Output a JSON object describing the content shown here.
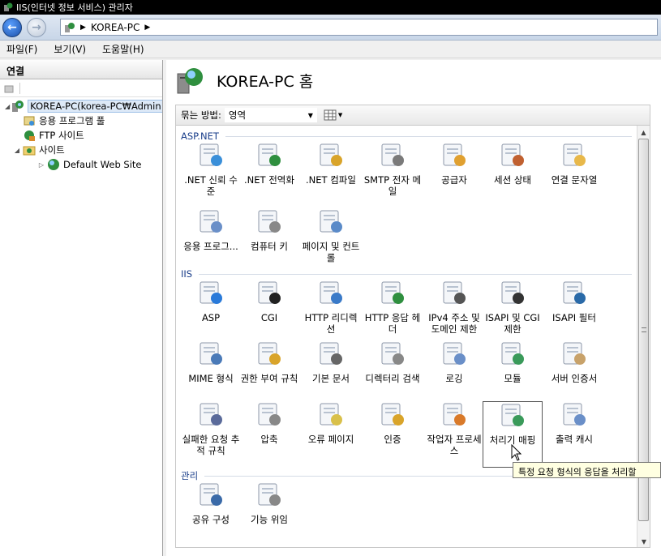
{
  "window": {
    "title": "IIS(인터넷 정보 서비스) 관리자"
  },
  "address": {
    "path": "KOREA-PC"
  },
  "menu": [
    "파일(F)",
    "보기(V)",
    "도움말(H)"
  ],
  "connections": {
    "title": "연결",
    "tree": [
      {
        "label": "KOREA-PC(korea-PC₩Admin"
      },
      {
        "label": "응용 프로그램 풀"
      },
      {
        "label": "FTP 사이트"
      },
      {
        "label": "사이트"
      },
      {
        "label": "Default Web Site"
      }
    ]
  },
  "main": {
    "title": "KOREA-PC 홈",
    "group_by_label": "묶는 방법:",
    "group_by_value": "영역",
    "sections": [
      {
        "name": "ASP.NET",
        "items": [
          ".NET 신뢰 수준",
          ".NET 전역화",
          ".NET 컴파일",
          "SMTP 전자 메일",
          "공급자",
          "세션 상태",
          "연결 문자열",
          "응용 프로그...",
          "컴퓨터 키",
          "페이지 및 컨트롤"
        ]
      },
      {
        "name": "IIS",
        "items": [
          "ASP",
          "CGI",
          "HTTP 리디렉션",
          "HTTP 응답 헤더",
          "IPv4 주소 및 도메인 제한",
          "ISAPI 및 CGI 제한",
          "ISAPI 필터",
          "MIME 형식",
          "권한 부여 규칙",
          "기본 문서",
          "디렉터리 검색",
          "로깅",
          "모듈",
          "서버 인증서",
          "실패한 요청 추적 규칙",
          "압축",
          "오류 페이지",
          "인증",
          "작업자 프로세스",
          "처리기 매핑",
          "출력 캐시"
        ]
      },
      {
        "name": "관리",
        "items": [
          "공유 구성",
          "기능 위임"
        ]
      }
    ],
    "tooltip": "특정 요청 형식의 응답을 처리할"
  },
  "colors": {
    "section": "#1a3e8a",
    "selection": "#dde9f7",
    "tooltip_bg": "#ffffe1"
  }
}
